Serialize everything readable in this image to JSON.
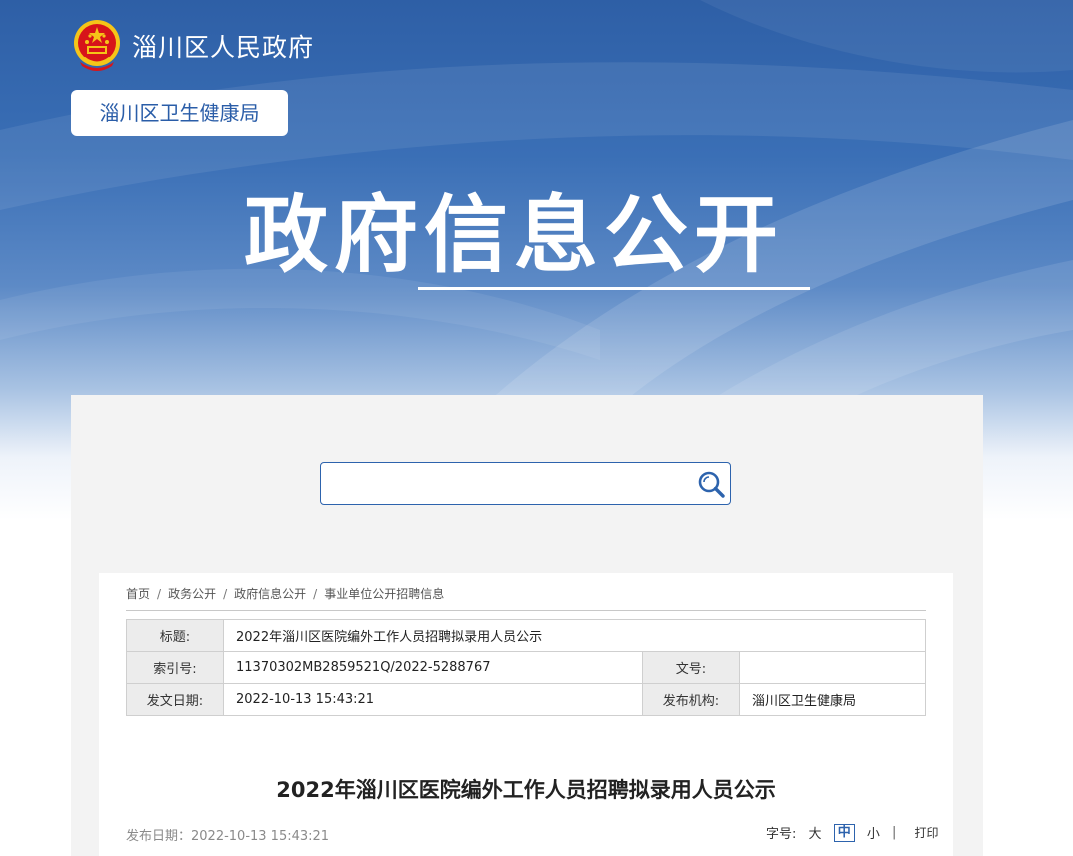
{
  "header": {
    "site_name": "淄川区人民政府",
    "department": "淄川区卫生健康局",
    "hero_title": "政府信息公开"
  },
  "search": {
    "placeholder": ""
  },
  "breadcrumb": {
    "items": [
      "首页",
      "政务公开",
      "政府信息公开",
      "事业单位公开招聘信息"
    ],
    "separator": "/"
  },
  "meta_table": {
    "title_label": "标题:",
    "title_value": "2022年淄川区医院编外工作人员招聘拟录用人员公示",
    "index_label": "索引号:",
    "index_value": "11370302MB2859521Q/2022-5288767",
    "doc_no_label": "文号:",
    "doc_no_value": "",
    "date_label": "发文日期:",
    "date_value": "2022-10-13 15:43:21",
    "org_label": "发布机构:",
    "org_value": "淄川区卫生健康局"
  },
  "article": {
    "title": "2022年淄川区医院编外工作人员招聘拟录用人员公示",
    "publish_date": "发布日期：2022-10-13 15:43:21"
  },
  "tools": {
    "font_size_label": "字号:",
    "large": "大",
    "medium": "中",
    "small": "小",
    "divider": "|",
    "print": "打印"
  },
  "colors": {
    "brand_blue": "#2d63ad",
    "emblem_red": "#d7141a",
    "emblem_gold": "#f5c518"
  },
  "icons": [
    "national-emblem-icon",
    "search-icon"
  ]
}
